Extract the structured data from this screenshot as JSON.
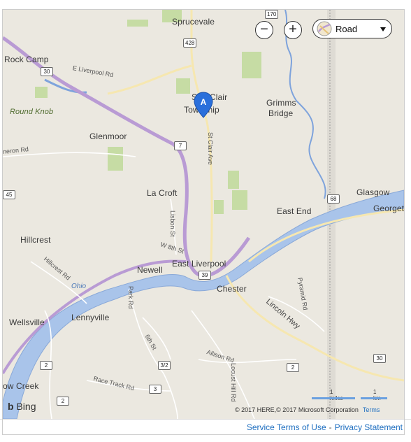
{
  "places": [
    {
      "id": "sprucevale",
      "label": "Sprucevale"
    },
    {
      "id": "rock-camp",
      "label": "Rock Camp"
    },
    {
      "id": "round-knob",
      "label": "Round Knob"
    },
    {
      "id": "st-clair-a",
      "label": "St"
    },
    {
      "id": "st-clair-b",
      "label": "Clair"
    },
    {
      "id": "township",
      "label": "Township"
    },
    {
      "id": "grimms",
      "label": "Grimms"
    },
    {
      "id": "bridge",
      "label": "Bridge"
    },
    {
      "id": "glenmoor",
      "label": "Glenmoor"
    },
    {
      "id": "la-croft",
      "label": "La Croft"
    },
    {
      "id": "glasgow",
      "label": "Glasgow"
    },
    {
      "id": "georgetown",
      "label": "Georget"
    },
    {
      "id": "east-end",
      "label": "East End"
    },
    {
      "id": "hillcrest",
      "label": "Hillcrest"
    },
    {
      "id": "newell",
      "label": "Newell"
    },
    {
      "id": "east-liverpool",
      "label": "East Liverpool"
    },
    {
      "id": "chester",
      "label": "Chester"
    },
    {
      "id": "wellsville",
      "label": "Wellsville"
    },
    {
      "id": "lennyville",
      "label": "Lennyville"
    },
    {
      "id": "yellow-creek",
      "label": "ow Creek"
    }
  ],
  "roads": [
    {
      "id": "e-liverpool-rd",
      "label": "E Liverpool Rd"
    },
    {
      "id": "meron-rd",
      "label": "neron Rd"
    },
    {
      "id": "st-clair-ave",
      "label": "St Clair Ave"
    },
    {
      "id": "lisbon-st",
      "label": "Lisbon St"
    },
    {
      "id": "w-8th-st",
      "label": "W 8th St"
    },
    {
      "id": "hillcrest-rd",
      "label": "Hillcrest Rd"
    },
    {
      "id": "park-rd",
      "label": "Park Rd"
    },
    {
      "id": "sixth-st",
      "label": "6th St"
    },
    {
      "id": "allison-rd",
      "label": "Allison Rd"
    },
    {
      "id": "race-track-rd",
      "label": "Race Track Rd"
    },
    {
      "id": "locust-hill-rd",
      "label": "Locust Hill Rd"
    },
    {
      "id": "lincoln-hwy",
      "label": "Lincoln Hwy"
    },
    {
      "id": "pyramid-rd",
      "label": "Pyramid Rd"
    }
  ],
  "water": [
    {
      "id": "ohio",
      "label": "Ohio"
    }
  ],
  "shields": [
    {
      "id": "r170",
      "label": "170"
    },
    {
      "id": "r428",
      "label": "428"
    },
    {
      "id": "r30a",
      "label": "30"
    },
    {
      "id": "r7",
      "label": "7"
    },
    {
      "id": "r45",
      "label": "45"
    },
    {
      "id": "r68",
      "label": "68"
    },
    {
      "id": "r39",
      "label": "39"
    },
    {
      "id": "r2a",
      "label": "2"
    },
    {
      "id": "r3_2",
      "label": "3/2"
    },
    {
      "id": "r2b",
      "label": "2"
    },
    {
      "id": "r3",
      "label": "3"
    },
    {
      "id": "r30b",
      "label": "30"
    },
    {
      "id": "r2c",
      "label": "2"
    }
  ],
  "controls": {
    "zoom_out": "−",
    "zoom_in": "+",
    "map_type": "Road",
    "pin_label": "A"
  },
  "scale": {
    "miles": "1 miles",
    "km": "1 km"
  },
  "attribution": {
    "text": "© 2017 HERE,© 2017 Microsoft Corporation",
    "terms": "Terms"
  },
  "brand": "Bing",
  "footer": {
    "service_terms": "Service Terms of Use",
    "separator": "-",
    "privacy": "Privacy Statement"
  },
  "colors": {
    "water": "#a9c4ea",
    "river": "#8fb0e6",
    "highway": "#b99bd4",
    "land": "#ebe8e0",
    "park": "#c6dca4",
    "accent": "#1f6fc0"
  }
}
